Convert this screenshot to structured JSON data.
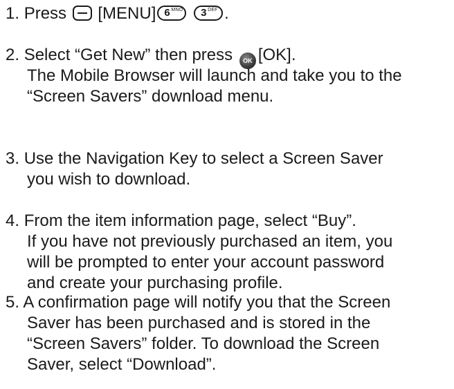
{
  "steps": [
    {
      "number": "1.",
      "parts": {
        "before": "Press",
        "menu_label": "[MENU]",
        "key_6_digit": "6",
        "key_6_letters": "MNO",
        "key_3_digit": "3",
        "key_3_letters": "DEF",
        "end": "."
      },
      "icons": [
        "left-soft-key-icon",
        "key-6-icon",
        "key-3-icon"
      ]
    },
    {
      "number": "2.",
      "line1_before": "Select “Get New” then press",
      "ok_icon_text": "OK",
      "line1_after": "[OK].",
      "line2": "The Mobile Browser will launch and take you to the",
      "line3": "“Screen Savers” download menu."
    },
    {
      "number": "3.",
      "line1": "Use the Navigation Key to select a Screen Saver",
      "line2": "you wish to download."
    },
    {
      "number": "4.",
      "line1": "From the item information page, select “Buy”.",
      "line2": "If you have not previously purchased an item, you",
      "line3": "will be prompted to enter your account password",
      "line4": "and create your purchasing profile."
    },
    {
      "number": "5.",
      "line1": "A confirmation page will notify you that the Screen",
      "line2": "Saver has been purchased and is stored in the",
      "line3": "“Screen Savers” folder. To download the Screen",
      "line4": "Saver, select “Download”."
    }
  ]
}
